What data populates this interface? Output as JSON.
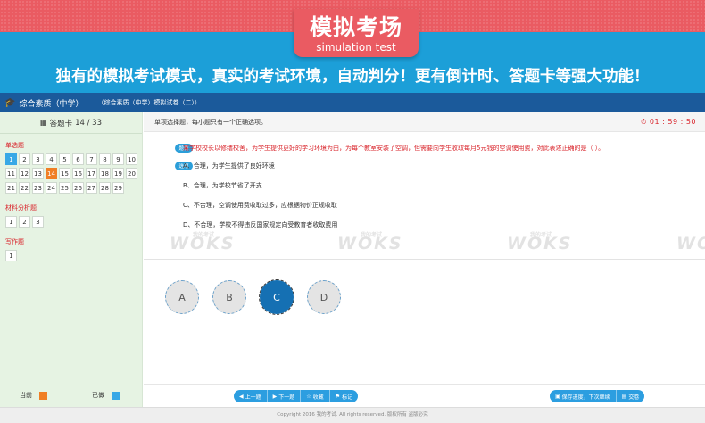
{
  "banner": {
    "title_cn": "模拟考场",
    "title_en": "simulation test",
    "slogan": "独有的模拟考试模式，真实的考试环境，自动判分！更有倒计时、答题卡等强大功能！"
  },
  "header": {
    "subject": "综合素质（中学）",
    "paper": "（综合素质（中学）模拟试卷（二））"
  },
  "card": {
    "label": "答题卡",
    "progress": "14 / 33",
    "sections": [
      {
        "title": "单选题",
        "numbers": [
          "1",
          "2",
          "3",
          "4",
          "5",
          "6",
          "7",
          "8",
          "9",
          "10",
          "11",
          "12",
          "13",
          "14",
          "15",
          "16",
          "17",
          "18",
          "19",
          "20",
          "21",
          "22",
          "23",
          "24",
          "25",
          "26",
          "27",
          "28",
          "29"
        ]
      },
      {
        "title": "材料分析题",
        "numbers": [
          "1",
          "2",
          "3"
        ]
      },
      {
        "title": "写作题",
        "numbers": [
          "1"
        ]
      }
    ],
    "legend_current": "当前",
    "legend_done": "已做"
  },
  "question": {
    "type_note": "单项选择题，每小题只有一个正确选项。",
    "timer": "01 : 59 : 50",
    "tag_stem": "题目",
    "tag_options": "选项",
    "stem": "某学校校长以修缮校舍，为学生提供更好的学习环境为由，为每个教室安装了空调，但需要向学生收取每月5元钱的空调使用费，对此表述正确的是（ ）。",
    "options": [
      "A、合理，为学生提供了良好环境",
      "B、合理，为学校节省了开支",
      "C、不合理，空调使用费收取过多，应根据物价正规收取",
      "D、不合理，学校不得违反国家规定向受教育者收取费用"
    ]
  },
  "watermark": {
    "text": "WOKS",
    "sub": "我的考试"
  },
  "answers": [
    "A",
    "B",
    "C",
    "D"
  ],
  "toolbar": {
    "prev": "上一题",
    "next": "下一题",
    "favorite": "收藏",
    "mark": "标记",
    "save": "保存进度，下次继续",
    "submit": "交卷"
  },
  "footer": "Copyright 2016 我的考试. All rights reserved. 版权所有 盗版必究",
  "colors": {
    "banner_red": "#ea5b62",
    "banner_blue": "#1c9fd8",
    "header_blue": "#1b5a9b",
    "current": "#f07e24",
    "done": "#38a8e6",
    "selected": "#1570b3"
  }
}
